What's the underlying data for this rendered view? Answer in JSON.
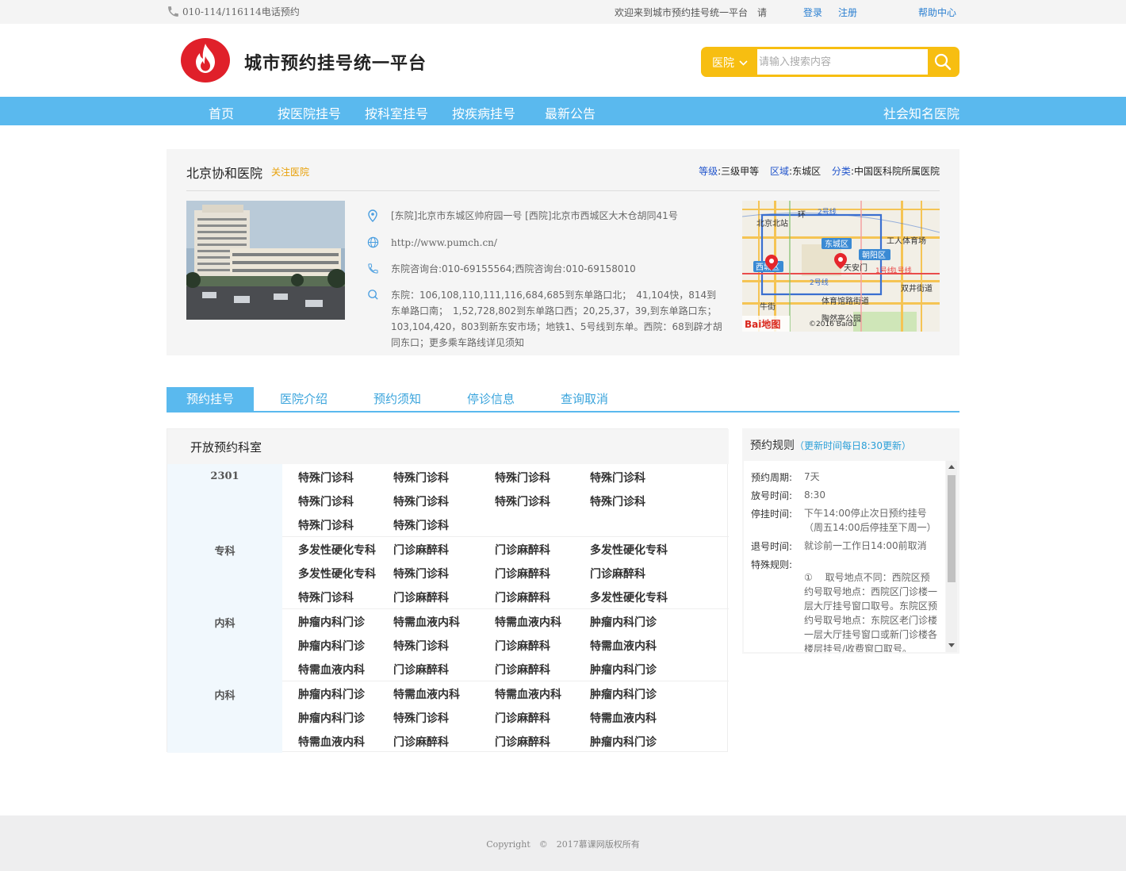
{
  "topbar": {
    "phone": "010-114/116114电话预约",
    "welcome": "欢迎来到城市预约挂号统一平台　请",
    "login": "登录",
    "register": "注册",
    "help": "帮助中心"
  },
  "header": {
    "title": "城市预约挂号统一平台",
    "search_type": "医院",
    "search_placeholder": "请输入搜索内容"
  },
  "nav": {
    "items": [
      "首页",
      "按医院挂号",
      "按科室挂号",
      "按疾病挂号",
      "最新公告"
    ],
    "right": "社会知名医院"
  },
  "hospital": {
    "name": "北京协和医院",
    "follow": "关注医院",
    "level_label": "等级",
    "level": "三级甲等",
    "area_label": "区域",
    "area": "东城区",
    "category_label": "分类",
    "category": "中国医科院所属医院",
    "address": "[东院]北京市东城区帅府园一号 [西院]北京市西城区大木仓胡同41号",
    "website": "http://www.pumch.cn/",
    "phone": "东院咨询台:010-69155564;西院咨询台:010-69158010",
    "transport": "东院：106,108,110,111,116,684,685到东单路口北；　41,104快，814到东单路口南；　1,52,728,802到东单路口西；20,25,37，39,到东单路口东；103,104,420，803到新东安市场；地铁1、5号线到东单。西院：68到辟才胡同东口；更多乘车路线详见须知"
  },
  "map": {
    "labels": [
      "北京北站",
      "东城区",
      "工人体育场",
      "西城区",
      "朝阳区",
      "天安门",
      "2号线",
      "1号线",
      "双井街道",
      "牛街",
      "体育馆路街道",
      "陶然亭公园",
      "©2016 Baidu",
      "环",
      "2号线",
      "1号线"
    ],
    "logo": "Bai地图"
  },
  "tabs": [
    "预约挂号",
    "医院介绍",
    "预约须知",
    "停诊信息",
    "查询取消"
  ],
  "departments": {
    "title": "开放预约科室",
    "groups": [
      {
        "name": "2301",
        "items": [
          "特殊门诊科",
          "特殊门诊科",
          "特殊门诊科",
          "特殊门诊科",
          "特殊门诊科",
          "特殊门诊科",
          "特殊门诊科",
          "特殊门诊科",
          "特殊门诊科",
          "特殊门诊科"
        ]
      },
      {
        "name": "专科",
        "items": [
          "多发性硬化专科",
          "门诊麻醉科",
          "门诊麻醉科",
          "多发性硬化专科",
          "多发性硬化专科",
          "特殊门诊科",
          "门诊麻醉科",
          "门诊麻醉科",
          "特殊门诊科",
          "门诊麻醉科",
          "门诊麻醉科",
          "多发性硬化专科"
        ]
      },
      {
        "name": "内科",
        "items": [
          "肿瘤内科门诊",
          "特需血液内科",
          "特需血液内科",
          "肿瘤内科门诊",
          "肿瘤内科门诊",
          "特殊门诊科",
          "门诊麻醉科",
          "特需血液内科",
          "特需血液内科",
          "门诊麻醉科",
          "门诊麻醉科",
          "肿瘤内科门诊"
        ]
      },
      {
        "name": "内科",
        "items": [
          "肿瘤内科门诊",
          "特需血液内科",
          "特需血液内科",
          "肿瘤内科门诊",
          "肿瘤内科门诊",
          "特殊门诊科",
          "门诊麻醉科",
          "特需血液内科",
          "特需血液内科",
          "门诊麻醉科",
          "门诊麻醉科",
          "肿瘤内科门诊"
        ]
      }
    ]
  },
  "rules": {
    "title": "预约规则",
    "subtitle": "（更新时间每日8:30更新）",
    "rows": [
      {
        "label": "预约周期:",
        "value": "7天"
      },
      {
        "label": "放号时间:",
        "value": "8:30"
      },
      {
        "label": "停挂时间:",
        "value": "下午14:00停止次日预约挂号\n（周五14:00后停挂至下周一）"
      },
      {
        "label": "退号时间:",
        "value": "就诊前一工作日14:00前取消"
      },
      {
        "label": "特殊规则:",
        "value": ""
      }
    ],
    "special": "①　 取号地点不同：西院区预约号取号地点：西院区门诊楼一层大厅挂号窗口取号。东院区预约号取号地点：东院区老门诊楼一层大厅挂号窗口或新门诊楼各楼层挂号/收费窗口取号。"
  },
  "footer": "Copyright　©　2017慕课网版权所有"
}
